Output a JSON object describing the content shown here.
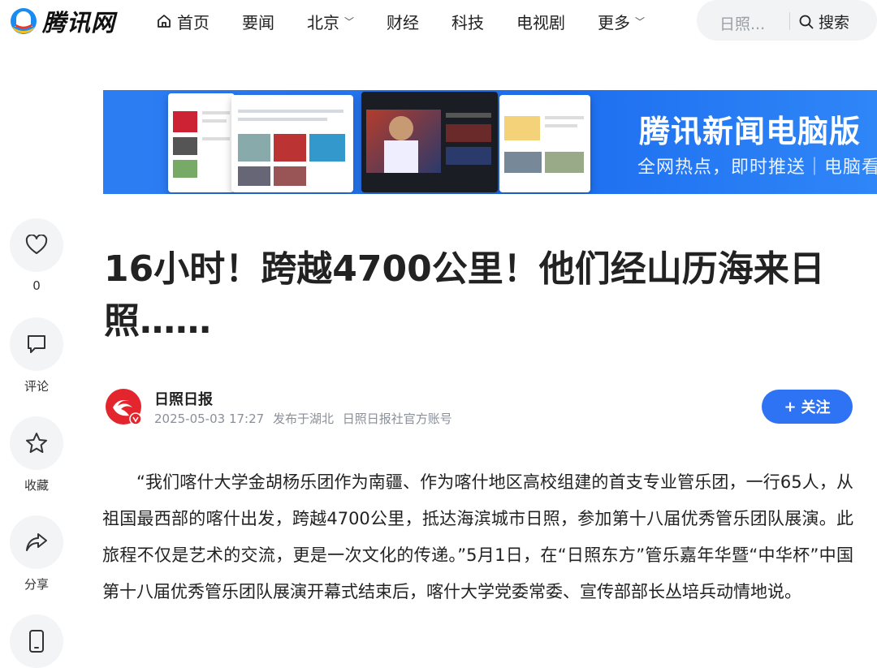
{
  "header": {
    "logo_text": "腾讯网",
    "nav": [
      {
        "label": "首页",
        "icon": "home-icon"
      },
      {
        "label": "要闻"
      },
      {
        "label": "北京",
        "dropdown": true
      },
      {
        "label": "财经"
      },
      {
        "label": "科技"
      },
      {
        "label": "电视剧"
      },
      {
        "label": "更多",
        "dropdown": true
      }
    ],
    "search": {
      "placeholder": "日照...",
      "button_label": "搜索"
    }
  },
  "banner": {
    "title": "腾讯新闻电脑版",
    "subtitle": "全网热点，即时推送｜电脑看"
  },
  "side_actions": [
    {
      "icon": "heart-icon",
      "label": "0"
    },
    {
      "icon": "comment-icon",
      "label": "评论"
    },
    {
      "icon": "star-icon",
      "label": "收藏"
    },
    {
      "icon": "share-icon",
      "label": "分享"
    },
    {
      "icon": "phone-icon",
      "label": ""
    }
  ],
  "article": {
    "title": "16小时！跨越4700公里！他们经山历海来日照……",
    "author": "日照日报",
    "date": "2025-05-03 17:27",
    "location": "发布于湖北",
    "account": "日照日报社官方账号",
    "follow_label": "关注",
    "body": "“我们喀什大学金胡杨乐团作为南疆、作为喀什地区高校组建的首支专业管乐团，一行65人，从祖国最西部的喀什出发，跨越4700公里，抵达海滨城市日照，参加第十八届优秀管乐团队展演。此旅程不仅是艺术的交流，更是一次文化的传递。”5月1日，在“日照东方”管乐嘉年华暨“中华杯”中国第十八届优秀管乐团队展演开幕式结束后，喀什大学党委常委、宣传部部长丛培兵动情地说。"
  },
  "colors": {
    "accent": "#2f73f5",
    "banner": "#1e6ff0",
    "avatar": "#e3262d"
  }
}
